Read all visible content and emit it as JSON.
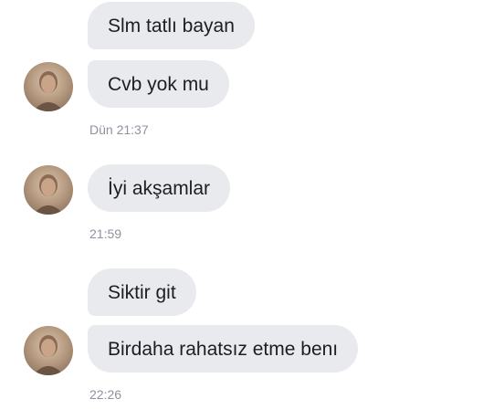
{
  "conversation": {
    "groups": [
      {
        "messages": [
          "Slm tatlı bayan",
          "Cvb yok mu"
        ],
        "time": "Dün 21:37"
      },
      {
        "messages": [
          "İyi akşamlar"
        ],
        "time": "21:59"
      },
      {
        "messages": [
          "Siktir git",
          "Birdaha rahatsız etme benı"
        ],
        "time": "22:26"
      }
    ],
    "avatar_icon": "user-avatar-photo",
    "colors": {
      "bubble_bg": "#e9eaee",
      "text": "#1c1e21",
      "timestamp": "#8d949e",
      "background": "#ffffff"
    }
  }
}
